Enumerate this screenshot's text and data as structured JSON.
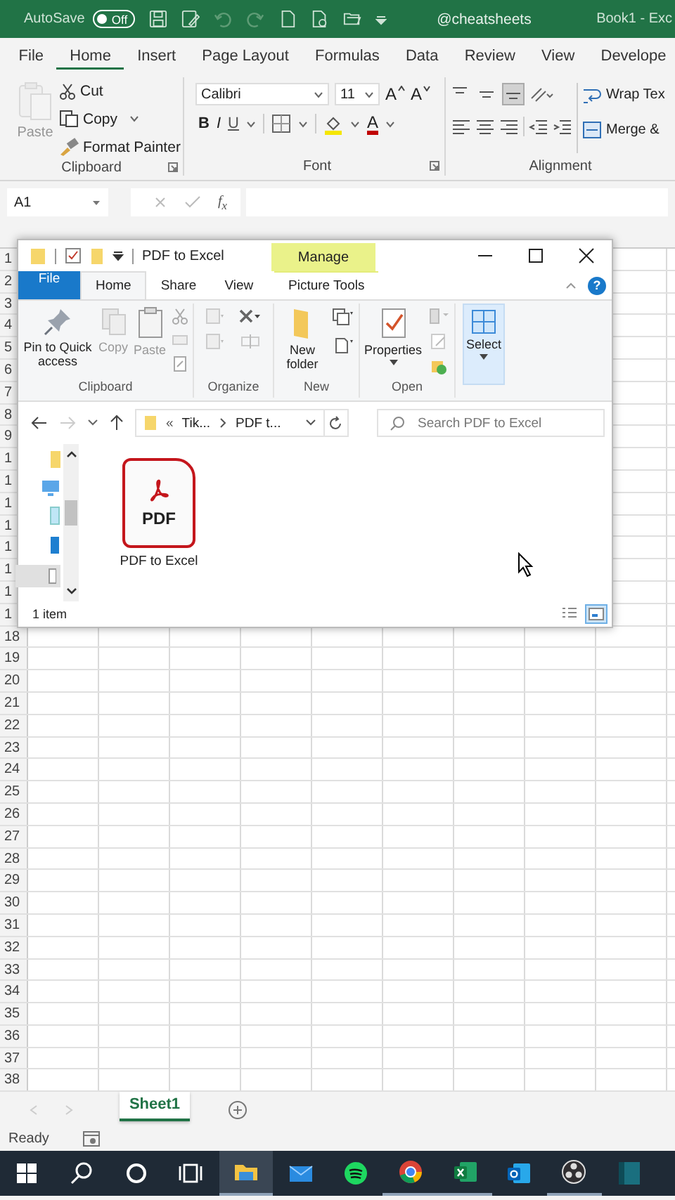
{
  "excel": {
    "title_bar": {
      "autosave": "AutoSave",
      "autosave_toggle": {
        "label": "Off",
        "on": false
      },
      "account": "@cheatsheets",
      "document": "Book1 - Exc"
    },
    "tabs": [
      {
        "label": "File",
        "selected": false
      },
      {
        "label": "Home",
        "selected": true
      },
      {
        "label": "Insert",
        "selected": false
      },
      {
        "label": "Page Layout",
        "selected": false
      },
      {
        "label": "Formulas",
        "selected": false
      },
      {
        "label": "Data",
        "selected": false
      },
      {
        "label": "Review",
        "selected": false
      },
      {
        "label": "View",
        "selected": false
      },
      {
        "label": "Develope",
        "selected": false
      }
    ],
    "clipboard": {
      "paste": {
        "label": "Paste",
        "disabled": true
      },
      "cut": "Cut",
      "copy": "Copy",
      "format_painter": "Format Painter",
      "label": "Clipboard"
    },
    "font": {
      "name": "Calibri",
      "size": "11",
      "grow": "A",
      "shrink": "A",
      "bold": "B",
      "italic": "I",
      "underline": "U",
      "font_color": "A",
      "label": "Font"
    },
    "alignment": {
      "vertical": [
        {
          "selected": false
        },
        {
          "selected": false
        },
        {
          "selected": true
        }
      ],
      "wrap_text": "Wrap Tex",
      "merge": "Merge &",
      "label": "Alignment"
    },
    "name_box": "A1",
    "function_label": "f$_{x}$",
    "row_headers": [
      "1",
      "2",
      "3",
      "4",
      "5",
      "6",
      "7",
      "8",
      "9",
      "1",
      "1",
      "1",
      "1",
      "1",
      "1",
      "1",
      "1",
      "18",
      "19",
      "20",
      "21",
      "22",
      "23",
      "24",
      "25",
      "26",
      "27",
      "28",
      "29",
      "30",
      "31",
      "32",
      "33",
      "34",
      "35",
      "36",
      "37",
      "38"
    ],
    "sheet_tabs": [
      {
        "label": "Sheet1",
        "selected": true
      }
    ],
    "status": "Ready"
  },
  "explorer": {
    "title": "PDF to Excel",
    "context_tab": "Manage",
    "tabs": [
      {
        "label": "File",
        "selected": false,
        "kind": "file"
      },
      {
        "label": "Home",
        "selected": true,
        "kind": "tab"
      },
      {
        "label": "Share",
        "selected": false,
        "kind": "tab"
      },
      {
        "label": "View",
        "selected": false,
        "kind": "tab"
      },
      {
        "label": "Picture Tools",
        "selected": false,
        "kind": "context"
      }
    ],
    "help": "?",
    "clipboard": {
      "pin": "Pin to Quick access",
      "copy": {
        "label": "Copy",
        "disabled": true
      },
      "paste": {
        "label": "Paste",
        "disabled": true
      },
      "label": "Clipboard"
    },
    "organize_label": "Organize",
    "new": {
      "new_folder": "New folder",
      "label": "New"
    },
    "open": {
      "properties": "Properties",
      "label": "Open"
    },
    "select": "Select",
    "address": {
      "overflow": "«",
      "crumbs": [
        "Tik...",
        "PDF t..."
      ]
    },
    "search": {
      "placeholder": "Search PDF to Excel"
    },
    "files": [
      {
        "name": "PDF to Excel",
        "badge": "PDF"
      }
    ],
    "status": "1 item",
    "views": [
      {
        "kind": "details",
        "selected": false
      },
      {
        "kind": "large",
        "selected": true
      }
    ]
  },
  "taskbar": [
    {
      "kind": "start",
      "selected": false,
      "running": false
    },
    {
      "kind": "search",
      "selected": false,
      "running": false
    },
    {
      "kind": "cortana",
      "selected": false,
      "running": false
    },
    {
      "kind": "taskview",
      "selected": false,
      "running": false
    },
    {
      "kind": "explorer",
      "selected": true,
      "running": true
    },
    {
      "kind": "mail",
      "selected": false,
      "running": false
    },
    {
      "kind": "spotify",
      "selected": false,
      "running": false
    },
    {
      "kind": "chrome",
      "selected": false,
      "running": true
    },
    {
      "kind": "excel",
      "selected": false,
      "running": true
    },
    {
      "kind": "outlook",
      "selected": false,
      "running": false
    },
    {
      "kind": "obs",
      "selected": false,
      "running": true
    },
    {
      "kind": "app",
      "selected": false,
      "running": false
    }
  ]
}
